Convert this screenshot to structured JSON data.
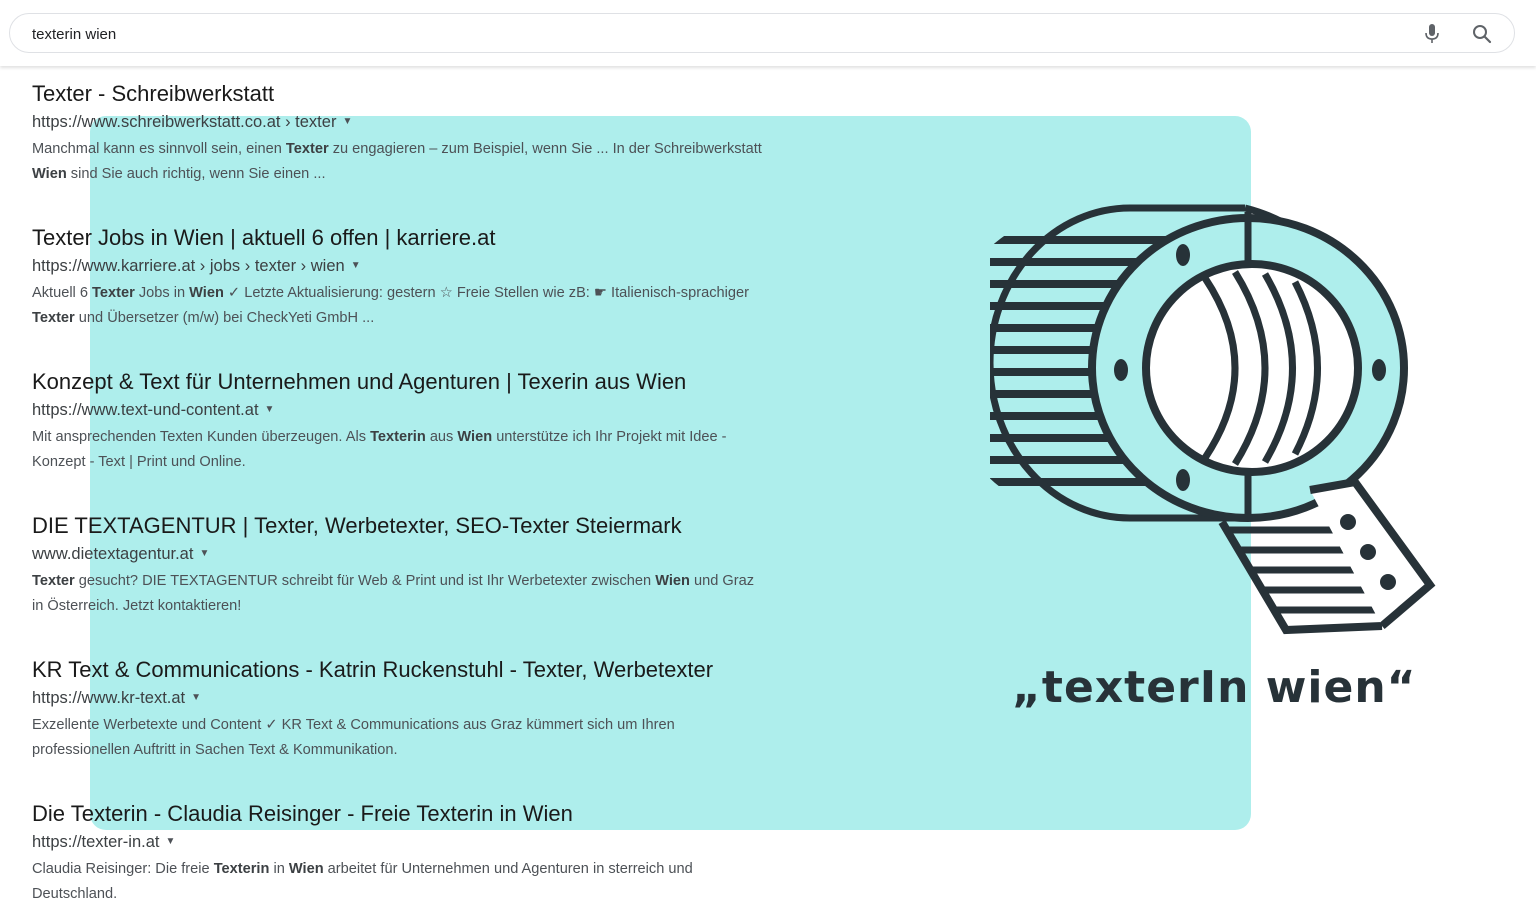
{
  "search": {
    "query": "texterin wien"
  },
  "icons": {
    "mic": "microphone-icon",
    "search": "search-icon",
    "logo": "magnifier-q-logo"
  },
  "colors": {
    "highlight": "#aeeeec",
    "logo": "#273238"
  },
  "tagline": "„texterIn wien“",
  "results": [
    {
      "title": "Texter - Schreibwerkstatt",
      "url": "https://www.schreibwerkstatt.co.at › texter",
      "snippet": [
        {
          "t": "Manchmal kann es sinnvoll sein, einen "
        },
        {
          "t": "Texter",
          "b": true
        },
        {
          "t": " zu engagieren – zum Beispiel, wenn Sie ... In der Schreibwerkstatt "
        },
        {
          "t": "Wien",
          "b": true
        },
        {
          "t": " sind Sie auch richtig, wenn Sie einen ..."
        }
      ]
    },
    {
      "title": "Texter Jobs in Wien | aktuell 6 offen | karriere.at",
      "url": "https://www.karriere.at › jobs › texter › wien",
      "snippet": [
        {
          "t": "Aktuell 6 "
        },
        {
          "t": "Texter",
          "b": true
        },
        {
          "t": " Jobs in "
        },
        {
          "t": "Wien",
          "b": true
        },
        {
          "t": " ✓ Letzte Aktualisierung: gestern ☆ Freie Stellen wie zB: ☛ Italienisch-sprachiger "
        },
        {
          "t": "Texter",
          "b": true
        },
        {
          "t": " und Übersetzer (m/w) bei CheckYeti GmbH ..."
        }
      ]
    },
    {
      "title": "Konzept & Text für Unternehmen und Agenturen | Texerin aus Wien",
      "url": "https://www.text-und-content.at",
      "snippet": [
        {
          "t": "Mit ansprechenden Texten Kunden überzeugen. Als "
        },
        {
          "t": "Texterin",
          "b": true
        },
        {
          "t": " aus "
        },
        {
          "t": "Wien",
          "b": true
        },
        {
          "t": " unterstütze ich Ihr Projekt mit Idee - Konzept - Text | Print und Online."
        }
      ]
    },
    {
      "title": "DIE TEXTAGENTUR | Texter, Werbetexter, SEO-Texter Steiermark",
      "url": "www.dietextagentur.at",
      "snippet": [
        {
          "t": "Texter",
          "b": true
        },
        {
          "t": " gesucht? DIE TEXTAGENTUR schreibt für Web & Print und ist Ihr Werbetexter zwischen "
        },
        {
          "t": "Wien",
          "b": true
        },
        {
          "t": " und Graz in Österreich. Jetzt kontaktieren!"
        }
      ]
    },
    {
      "title": "KR Text & Communications - Katrin Ruckenstuhl - Texter, Werbetexter",
      "url": "https://www.kr-text.at",
      "snippet": [
        {
          "t": "Exzellente Werbetexte und Content ✓ KR Text & Communications aus Graz kümmert sich um Ihren professionellen Auftritt in Sachen Text & Kommunikation."
        }
      ]
    },
    {
      "title": "Die Texterin - Claudia Reisinger - Freie Texterin in Wien",
      "url": "https://texter-in.at",
      "snippet": [
        {
          "t": "Claudia Reisinger: Die freie "
        },
        {
          "t": "Texterin",
          "b": true
        },
        {
          "t": " in "
        },
        {
          "t": "Wien",
          "b": true
        },
        {
          "t": " arbeitet für Unternehmen und Agenturen in sterreich und Deutschland."
        }
      ]
    }
  ]
}
